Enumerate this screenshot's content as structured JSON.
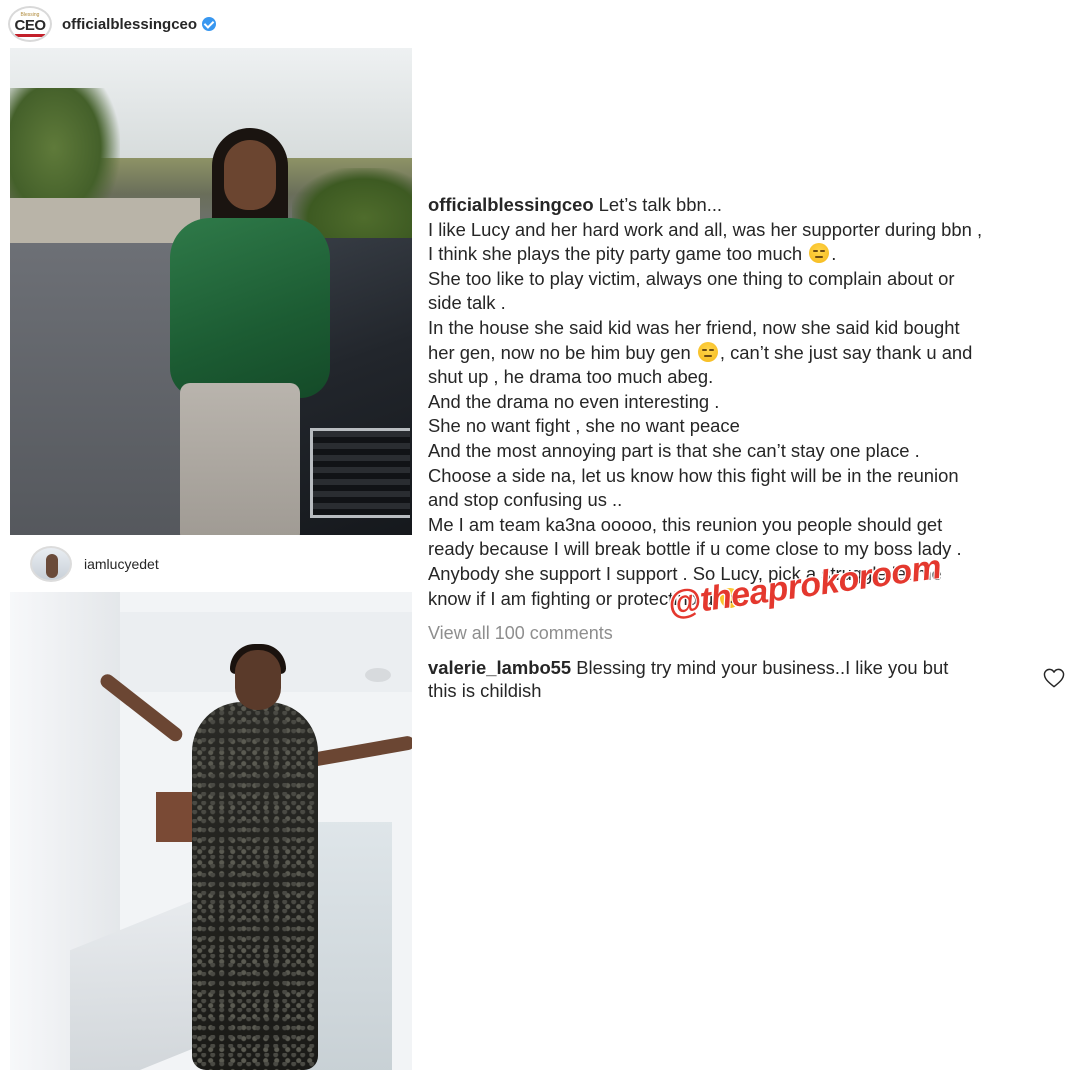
{
  "post1": {
    "avatar_logo_small": "Blessing",
    "avatar_logo": "CEO",
    "username": "officialblessingceo"
  },
  "post2": {
    "username": "iamlucyedet"
  },
  "caption": {
    "username": "officialblessingceo",
    "lines": [
      " Let’s talk bbn...",
      "I like Lucy and her hard work and all, was her supporter during bbn ,",
      "I think she plays the pity party game too much ",
      "She too like to play victim, always one thing to complain about or",
      "side talk .",
      "In the house she said kid was her friend, now she said kid bought",
      "her gen, now no be him buy gen ",
      ", can’t she just say thank u and",
      "shut up , he drama too much abeg.",
      "And the drama no even interesting .",
      "She no want fight , she no want peace",
      "And the most annoying part is that she can’t stay one place .",
      "Choose a side na, let us know how this fight will be in the reunion",
      "and stop confusing us ..",
      "Me I am team ka3na ooooo, this reunion you people should get",
      "ready because I will break bottle if u come close to my boss  lady .",
      "Anybody she support I support . So Lucy, pick a struggle let me",
      "know if I am fighting or protecting u ",
      "."
    ]
  },
  "view_all_comments": "View all 100 comments",
  "comment": {
    "username": "valerie_lambo55",
    "line1": " Blessing try mind your business..I like you but",
    "line2": "this is childish"
  },
  "watermark": "@theaprokoroom",
  "colors": {
    "verified_badge": "#3897f0",
    "muted_text": "#8e8e8e",
    "watermark": "#e4382e",
    "shirt_green": "#2f7a49"
  },
  "icons": [
    "verified-badge-icon",
    "smirk-emoji-icon",
    "pensive-emoji-icon",
    "laughing-emoji-icon",
    "heart-icon"
  ]
}
